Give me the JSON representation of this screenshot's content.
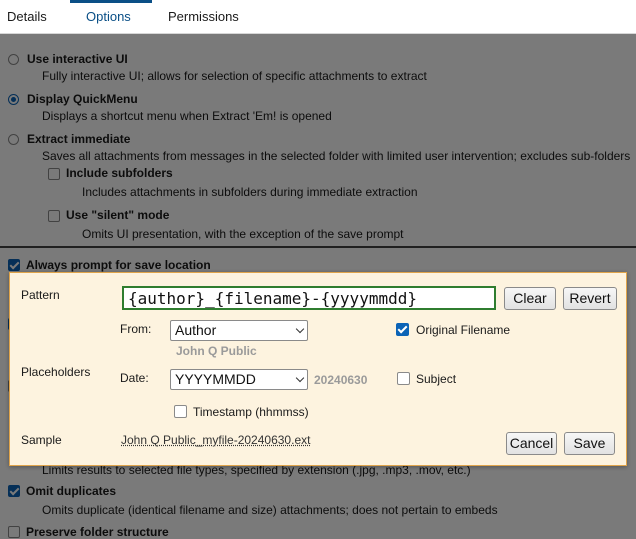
{
  "tabs": [
    {
      "label": "Details"
    },
    {
      "label": "Options"
    },
    {
      "label": "Permissions"
    }
  ],
  "options": {
    "interactive": {
      "label": "Use interactive UI",
      "desc": "Fully interactive UI; allows for selection of specific attachments to extract"
    },
    "quickmenu": {
      "label": "Display QuickMenu",
      "desc": "Displays a shortcut menu when Extract 'Em! is opened"
    },
    "immediate": {
      "label": "Extract immediate",
      "desc": "Saves all attachments from messages in the selected folder with limited user intervention; excludes sub-folders"
    },
    "subfolders": {
      "label": "Include subfolders",
      "desc": "Includes attachments in subfolders during immediate extraction"
    },
    "silent": {
      "label": "Use \"silent\" mode",
      "desc": "Omits UI presentation, with the exception of the save prompt"
    },
    "always_prompt": {
      "label": "Always prompt for save location"
    },
    "filetypes": {
      "desc": "Limits results to selected file types, specified by extension (.jpg, .mp3, .mov, etc.)"
    },
    "duplicates": {
      "label": "Omit duplicates",
      "desc": "Omits duplicate (identical filename and size) attachments; does not pertain to embeds"
    },
    "preserve": {
      "label": "Preserve folder structure"
    }
  },
  "dialog": {
    "pattern_label": "Pattern",
    "pattern_value": "{author}_{filename}-{yyyymmdd}",
    "clear_label": "Clear",
    "revert_label": "Revert",
    "placeholders_label": "Placeholders",
    "from_label": "From:",
    "from_value": "Author",
    "from_hint": "John Q Public",
    "date_label": "Date:",
    "date_value": "YYYYMMDD",
    "date_hint": "20240630",
    "original_filename_label": "Original Filename",
    "subject_label": "Subject",
    "timestamp_label": "Timestamp (hhmmss)",
    "sample_label": "Sample",
    "sample_value": "John Q Public_myfile-20240630.ext",
    "cancel_label": "Cancel",
    "save_label": "Save"
  }
}
